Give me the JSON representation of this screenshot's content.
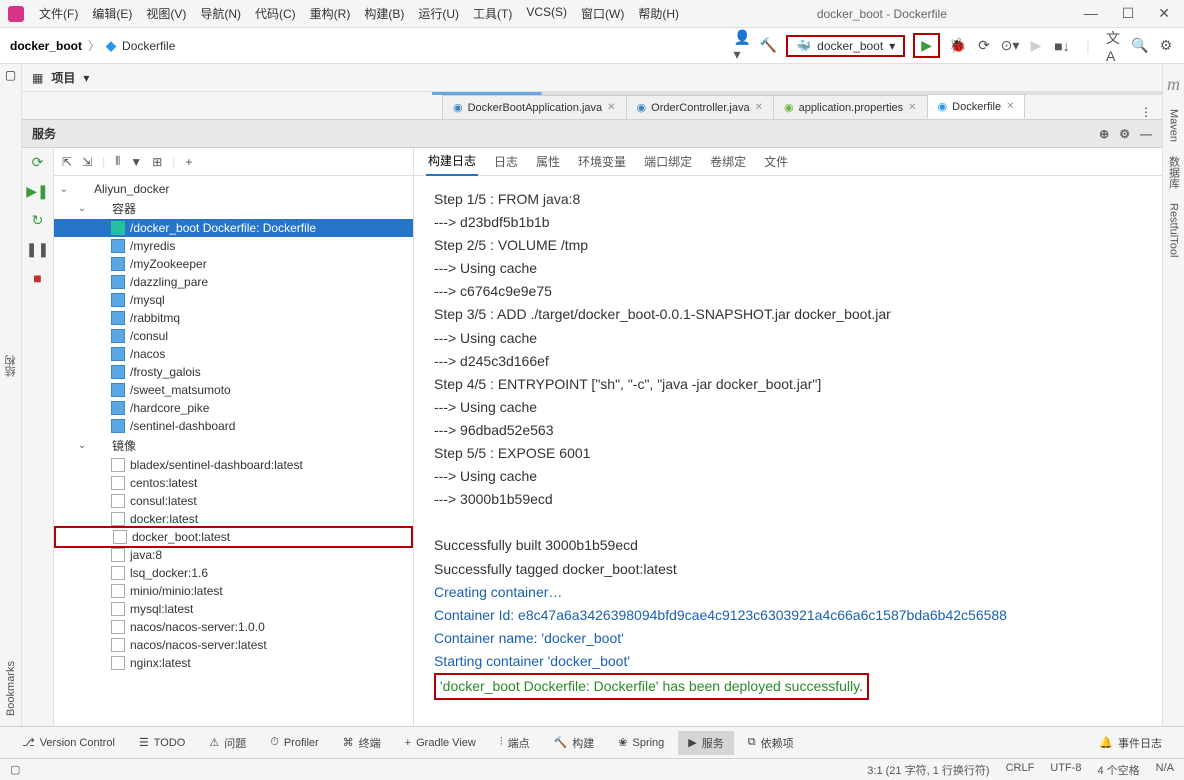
{
  "window": {
    "title": "docker_boot - Dockerfile",
    "menus": [
      "文件(F)",
      "编辑(E)",
      "视图(V)",
      "导航(N)",
      "代码(C)",
      "重构(R)",
      "构建(B)",
      "运行(U)",
      "工具(T)",
      "VCS(S)",
      "窗口(W)",
      "帮助(H)"
    ]
  },
  "breadcrumb": {
    "project": "docker_boot",
    "file": "Dockerfile"
  },
  "run_config": {
    "label": "docker_boot"
  },
  "project_tool": {
    "label": "项目"
  },
  "editor_tabs": [
    {
      "label": "DockerBootApplication.java",
      "icon": "java",
      "active": false
    },
    {
      "label": "OrderController.java",
      "icon": "java",
      "active": false
    },
    {
      "label": "application.properties",
      "icon": "props",
      "active": false
    },
    {
      "label": "Dockerfile",
      "icon": "docker",
      "active": true
    }
  ],
  "services_header": "服务",
  "tree": {
    "root": "Aliyun_docker",
    "containers_label": "容器",
    "containers": [
      "/docker_boot Dockerfile: Dockerfile",
      "/myredis",
      "/myZookeeper",
      "/dazzling_pare",
      "/mysql",
      "/rabbitmq",
      "/consul",
      "/nacos",
      "/frosty_galois",
      "/sweet_matsumoto",
      "/hardcore_pike",
      "/sentinel-dashboard"
    ],
    "images_label": "镜像",
    "images": [
      "bladex/sentinel-dashboard:latest",
      "centos:latest",
      "consul:latest",
      "docker:latest",
      "docker_boot:latest",
      "java:8",
      "lsq_docker:1.6",
      "minio/minio:latest",
      "mysql:latest",
      "nacos/nacos-server:1.0.0",
      "nacos/nacos-server:latest",
      "nginx:latest"
    ],
    "highlighted_image_index": 4
  },
  "console_tabs": [
    "构建日志",
    "日志",
    "属性",
    "环境变量",
    "端口绑定",
    "卷绑定",
    "文件"
  ],
  "console": {
    "plain": [
      "Step 1/5 : FROM java:8",
      " ---> d23bdf5b1b1b",
      "Step 2/5 : VOLUME /tmp",
      " ---> Using cache",
      " ---> c6764c9e9e75",
      "Step 3/5 : ADD ./target/docker_boot-0.0.1-SNAPSHOT.jar docker_boot.jar",
      " ---> Using cache",
      " ---> d245c3d166ef",
      "Step 4/5 : ENTRYPOINT [\"sh\", \"-c\", \"java -jar docker_boot.jar\"]",
      " ---> Using cache",
      " ---> 96dbad52e563",
      "Step 5/5 : EXPOSE 6001",
      " ---> Using cache",
      " ---> 3000b1b59ecd",
      "",
      "Successfully built 3000b1b59ecd",
      "Successfully tagged docker_boot:latest"
    ],
    "blue": [
      "Creating container…",
      "Container Id: e8c47a6a3426398094bfd9cae4c9123c6303921a4c66a6c1587bda6b42c56588",
      "Container name: 'docker_boot'",
      "Starting container 'docker_boot'"
    ],
    "green": "'docker_boot Dockerfile: Dockerfile' has been deployed successfully."
  },
  "bottom_tabs": [
    "Version Control",
    "TODO",
    "问题",
    "Profiler",
    "终端",
    "Gradle View",
    "端点",
    "构建",
    "Spring",
    "服务",
    "依赖项"
  ],
  "bottom_active_index": 9,
  "event_log": "事件日志",
  "status": {
    "pos": "3:1 (21 字符, 1 行换行符)",
    "line_sep": "CRLF",
    "encoding": "UTF-8",
    "indent": "4 个空格",
    "extra": "N/A"
  },
  "left_gutter": {
    "structure": "结构",
    "bookmarks": "Bookmarks"
  },
  "right_gutter": {
    "maven": "Maven",
    "db": "数据库",
    "restful": "RestfulTool"
  },
  "right_gutter_m": "m"
}
